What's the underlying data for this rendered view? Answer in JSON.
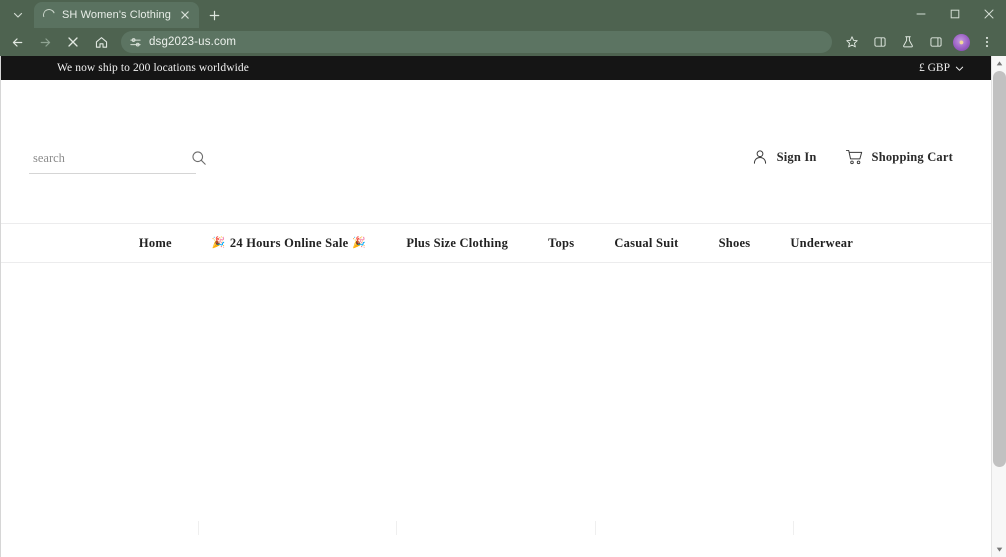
{
  "browser": {
    "tab": {
      "title": "SH Women's Clothing",
      "spinner_name": "loading-spinner-icon",
      "close_label": "✕"
    },
    "tab_search_label": "⌄",
    "new_tab_label": "+",
    "window_controls": {
      "minimize": "–",
      "maximize": "□",
      "close": "✕"
    },
    "toolbar": {
      "back_label": "←",
      "forward_label": "→",
      "stop_label": "✕",
      "home_label": "⌂",
      "url": "dsg2023-us.com",
      "bookmark_label": "☆",
      "split_label": "⧉",
      "labs_label": "⚗",
      "sidepanel_label": "◫",
      "menu_label": "⋮",
      "avatar_glyph": "👤"
    }
  },
  "site": {
    "announcement": {
      "text": "We now ship to 200 locations worldwide",
      "currency": "£ GBP",
      "currency_chevron": "⌄"
    },
    "search": {
      "placeholder": "search",
      "value": "",
      "button_name": "search-icon"
    },
    "account": [
      {
        "label": "Sign In",
        "icon": "user-icon"
      },
      {
        "label": "Shopping Cart",
        "icon": "cart-icon"
      }
    ],
    "nav": [
      {
        "label": "Home",
        "emoji_left": "",
        "emoji_right": ""
      },
      {
        "label": "24 Hours Online Sale",
        "emoji_left": "🎉",
        "emoji_right": "🎉"
      },
      {
        "label": "Plus Size Clothing",
        "emoji_left": "",
        "emoji_right": ""
      },
      {
        "label": "Tops",
        "emoji_left": "",
        "emoji_right": ""
      },
      {
        "label": "Casual Suit",
        "emoji_left": "",
        "emoji_right": ""
      },
      {
        "label": "Shoes",
        "emoji_left": "",
        "emoji_right": ""
      },
      {
        "label": "Underwear",
        "emoji_left": "",
        "emoji_right": ""
      }
    ]
  },
  "scrollbar": {
    "up_label": "▲",
    "down_label": "▼"
  },
  "colors": {
    "chrome": "#4e6350",
    "tab_active": "#5a7260",
    "announce_bg": "#151515",
    "page_bg": "#ffffff",
    "avatar": "#9a5fc4"
  }
}
